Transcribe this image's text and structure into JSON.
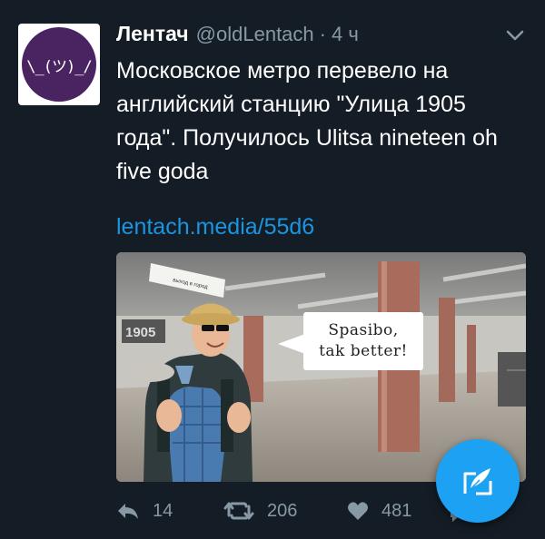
{
  "tweet": {
    "author_name": "Лентач",
    "author_handle": "@oldLentach",
    "separator": "·",
    "time": "4 ч",
    "avatar_text": "\\_(ツ)_/",
    "text": "Московское метро перевело на английский станцию \"Улица 1905 года\". Получилось Ulitsa nineteen oh five goda",
    "link": "lentach.media/55d6",
    "image": {
      "bubble_line1": "Spasibo,",
      "bubble_line2": "tak better!",
      "sign_text": "выход в город",
      "wall_text": "1905"
    }
  },
  "actions": {
    "reply_count": "14",
    "retweet_count": "206",
    "like_count": "481"
  },
  "colors": {
    "background": "#141d26",
    "accent": "#1da1f2",
    "link": "#1b95e0",
    "muted": "#8899a6"
  },
  "icons": {
    "menu": "chevron-down-icon",
    "reply": "reply-icon",
    "retweet": "retweet-icon",
    "like": "heart-icon",
    "compose": "compose-icon"
  }
}
